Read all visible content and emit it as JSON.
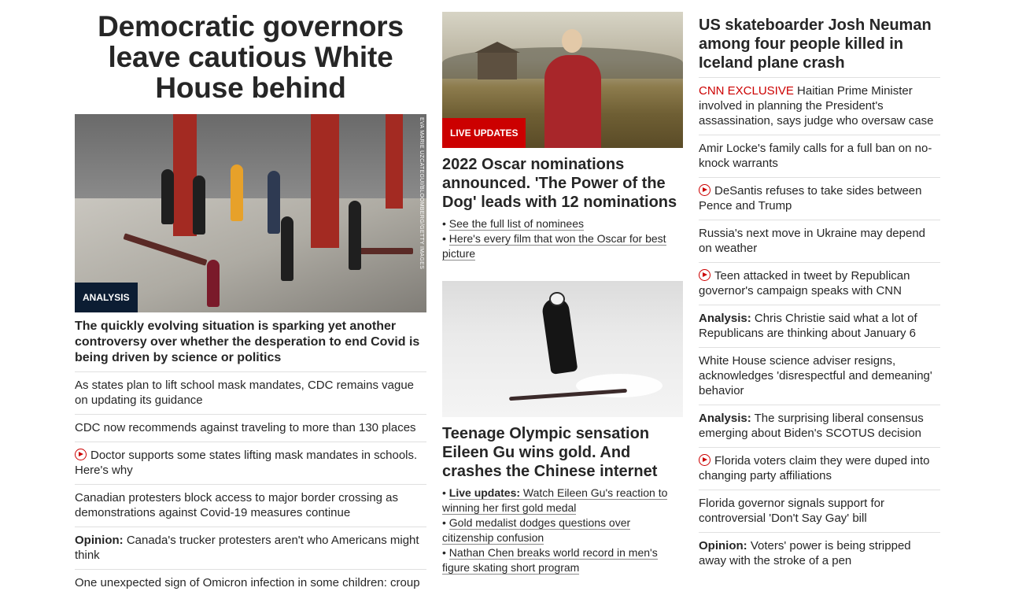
{
  "col1": {
    "headline": "Democratic governors leave cautious White House behind",
    "hero_tag": "ANALYSIS",
    "hero_credit": "EVA MARIE UZCATEGUI/BLOOMBERG/GETTY IMAGES",
    "subheadline": "The quickly evolving situation is sparking yet another controversy over whether the desperation to end Covid is being driven by science or politics",
    "stories": [
      {
        "text": "As states plan to lift school mask mandates, CDC remains vague on updating its guidance"
      },
      {
        "text": "CDC now recommends against traveling to more than 130 places"
      },
      {
        "text": "Doctor supports some states lifting mask mandates in schools. Here's why",
        "icon": "play-icon"
      },
      {
        "text": "Canadian protesters block access to major border crossing as demonstrations against Covid-19 measures continue"
      },
      {
        "label": "Opinion:",
        "text": " Canada's trucker protesters aren't who Americans might think"
      },
      {
        "text": "One unexpected sign of Omicron infection in some children: croup"
      }
    ]
  },
  "col2": {
    "oscar_tag": "LIVE UPDATES",
    "oscar_headline": "2022 Oscar nominations announced. 'The Power of the Dog' leads with 12 nominations",
    "oscar_bullets": [
      "See the full list of nominees",
      "Here's every film that won the Oscar for best picture"
    ],
    "ski_headline": "Teenage Olympic sensation Eileen Gu wins gold. And crashes the Chinese internet",
    "ski_bullets": [
      {
        "label": "Live updates:",
        "text": " Watch Eileen Gu's reaction to winning her first gold medal"
      },
      {
        "text": "Gold medalist dodges questions over citizenship confusion"
      },
      {
        "text": "Nathan Chen breaks world record in men's figure skating short program"
      }
    ]
  },
  "col3": {
    "headline": "US skateboarder Josh Neuman among four people killed in Iceland plane crash",
    "stories": [
      {
        "label_red": "CNN EXCLUSIVE",
        "text": " Haitian Prime Minister involved in planning the President's assassination, says judge who oversaw case"
      },
      {
        "text": "Amir Locke's family calls for a full ban on no-knock warrants"
      },
      {
        "text": "DeSantis refuses to take sides between Pence and Trump",
        "icon": "play-icon"
      },
      {
        "text": "Russia's next move in Ukraine may depend on weather"
      },
      {
        "text": "Teen attacked in tweet by Republican governor's campaign speaks with CNN",
        "icon": "play-icon"
      },
      {
        "label": "Analysis:",
        "text": " Chris Christie said what a lot of Republicans are thinking about January 6"
      },
      {
        "text": "White House science adviser resigns, acknowledges 'disrespectful and demeaning' behavior"
      },
      {
        "label": "Analysis:",
        "text": " The surprising liberal consensus emerging about Biden's SCOTUS decision"
      },
      {
        "text": "Florida voters claim they were duped into changing party affiliations",
        "icon": "play-icon"
      },
      {
        "text": "Florida governor signals support for controversial 'Don't Say Gay' bill"
      },
      {
        "label": "Opinion:",
        "text": " Voters' power is being stripped away with the stroke of a pen"
      }
    ]
  }
}
